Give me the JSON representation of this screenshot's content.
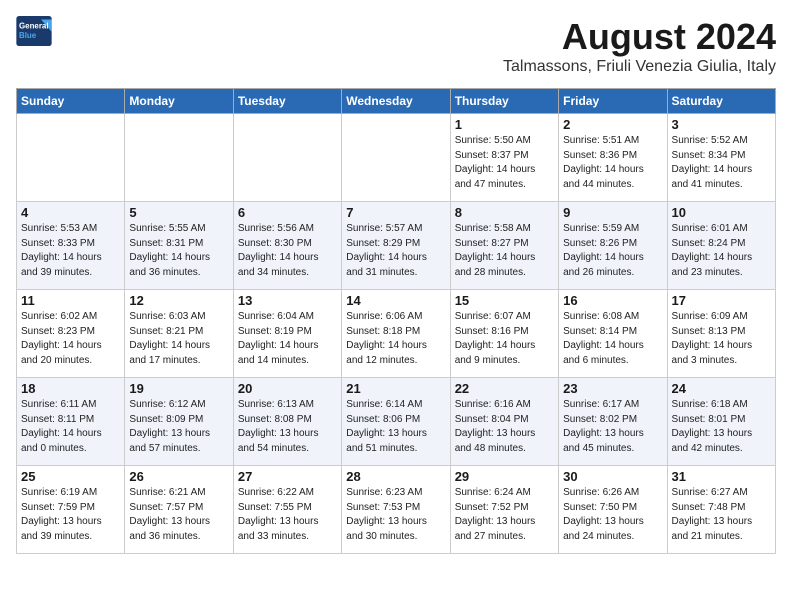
{
  "header": {
    "logo_line1": "General",
    "logo_line2": "Blue",
    "month": "August 2024",
    "location": "Talmassons, Friuli Venezia Giulia, Italy"
  },
  "weekdays": [
    "Sunday",
    "Monday",
    "Tuesday",
    "Wednesday",
    "Thursday",
    "Friday",
    "Saturday"
  ],
  "weeks": [
    [
      {
        "day": "",
        "info": ""
      },
      {
        "day": "",
        "info": ""
      },
      {
        "day": "",
        "info": ""
      },
      {
        "day": "",
        "info": ""
      },
      {
        "day": "1",
        "info": "Sunrise: 5:50 AM\nSunset: 8:37 PM\nDaylight: 14 hours\nand 47 minutes."
      },
      {
        "day": "2",
        "info": "Sunrise: 5:51 AM\nSunset: 8:36 PM\nDaylight: 14 hours\nand 44 minutes."
      },
      {
        "day": "3",
        "info": "Sunrise: 5:52 AM\nSunset: 8:34 PM\nDaylight: 14 hours\nand 41 minutes."
      }
    ],
    [
      {
        "day": "4",
        "info": "Sunrise: 5:53 AM\nSunset: 8:33 PM\nDaylight: 14 hours\nand 39 minutes."
      },
      {
        "day": "5",
        "info": "Sunrise: 5:55 AM\nSunset: 8:31 PM\nDaylight: 14 hours\nand 36 minutes."
      },
      {
        "day": "6",
        "info": "Sunrise: 5:56 AM\nSunset: 8:30 PM\nDaylight: 14 hours\nand 34 minutes."
      },
      {
        "day": "7",
        "info": "Sunrise: 5:57 AM\nSunset: 8:29 PM\nDaylight: 14 hours\nand 31 minutes."
      },
      {
        "day": "8",
        "info": "Sunrise: 5:58 AM\nSunset: 8:27 PM\nDaylight: 14 hours\nand 28 minutes."
      },
      {
        "day": "9",
        "info": "Sunrise: 5:59 AM\nSunset: 8:26 PM\nDaylight: 14 hours\nand 26 minutes."
      },
      {
        "day": "10",
        "info": "Sunrise: 6:01 AM\nSunset: 8:24 PM\nDaylight: 14 hours\nand 23 minutes."
      }
    ],
    [
      {
        "day": "11",
        "info": "Sunrise: 6:02 AM\nSunset: 8:23 PM\nDaylight: 14 hours\nand 20 minutes."
      },
      {
        "day": "12",
        "info": "Sunrise: 6:03 AM\nSunset: 8:21 PM\nDaylight: 14 hours\nand 17 minutes."
      },
      {
        "day": "13",
        "info": "Sunrise: 6:04 AM\nSunset: 8:19 PM\nDaylight: 14 hours\nand 14 minutes."
      },
      {
        "day": "14",
        "info": "Sunrise: 6:06 AM\nSunset: 8:18 PM\nDaylight: 14 hours\nand 12 minutes."
      },
      {
        "day": "15",
        "info": "Sunrise: 6:07 AM\nSunset: 8:16 PM\nDaylight: 14 hours\nand 9 minutes."
      },
      {
        "day": "16",
        "info": "Sunrise: 6:08 AM\nSunset: 8:14 PM\nDaylight: 14 hours\nand 6 minutes."
      },
      {
        "day": "17",
        "info": "Sunrise: 6:09 AM\nSunset: 8:13 PM\nDaylight: 14 hours\nand 3 minutes."
      }
    ],
    [
      {
        "day": "18",
        "info": "Sunrise: 6:11 AM\nSunset: 8:11 PM\nDaylight: 14 hours\nand 0 minutes."
      },
      {
        "day": "19",
        "info": "Sunrise: 6:12 AM\nSunset: 8:09 PM\nDaylight: 13 hours\nand 57 minutes."
      },
      {
        "day": "20",
        "info": "Sunrise: 6:13 AM\nSunset: 8:08 PM\nDaylight: 13 hours\nand 54 minutes."
      },
      {
        "day": "21",
        "info": "Sunrise: 6:14 AM\nSunset: 8:06 PM\nDaylight: 13 hours\nand 51 minutes."
      },
      {
        "day": "22",
        "info": "Sunrise: 6:16 AM\nSunset: 8:04 PM\nDaylight: 13 hours\nand 48 minutes."
      },
      {
        "day": "23",
        "info": "Sunrise: 6:17 AM\nSunset: 8:02 PM\nDaylight: 13 hours\nand 45 minutes."
      },
      {
        "day": "24",
        "info": "Sunrise: 6:18 AM\nSunset: 8:01 PM\nDaylight: 13 hours\nand 42 minutes."
      }
    ],
    [
      {
        "day": "25",
        "info": "Sunrise: 6:19 AM\nSunset: 7:59 PM\nDaylight: 13 hours\nand 39 minutes."
      },
      {
        "day": "26",
        "info": "Sunrise: 6:21 AM\nSunset: 7:57 PM\nDaylight: 13 hours\nand 36 minutes."
      },
      {
        "day": "27",
        "info": "Sunrise: 6:22 AM\nSunset: 7:55 PM\nDaylight: 13 hours\nand 33 minutes."
      },
      {
        "day": "28",
        "info": "Sunrise: 6:23 AM\nSunset: 7:53 PM\nDaylight: 13 hours\nand 30 minutes."
      },
      {
        "day": "29",
        "info": "Sunrise: 6:24 AM\nSunset: 7:52 PM\nDaylight: 13 hours\nand 27 minutes."
      },
      {
        "day": "30",
        "info": "Sunrise: 6:26 AM\nSunset: 7:50 PM\nDaylight: 13 hours\nand 24 minutes."
      },
      {
        "day": "31",
        "info": "Sunrise: 6:27 AM\nSunset: 7:48 PM\nDaylight: 13 hours\nand 21 minutes."
      }
    ]
  ]
}
